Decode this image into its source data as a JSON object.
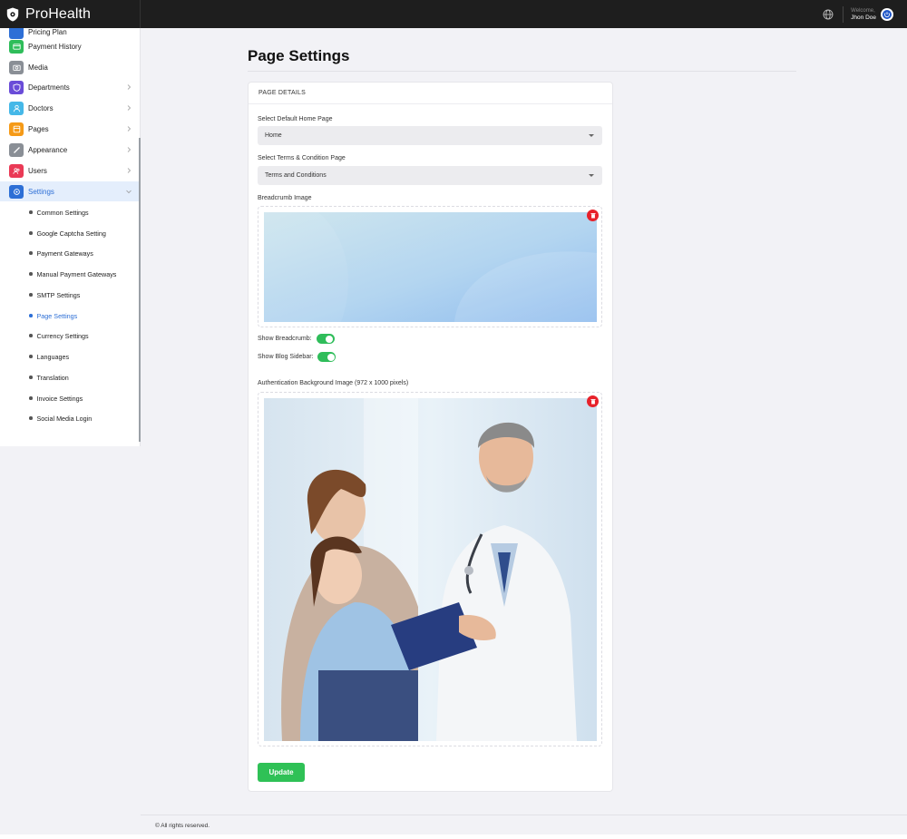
{
  "app": {
    "name": "ProHealth"
  },
  "topbar": {
    "welcome_label": "Welcome,",
    "user_name": "Jhon Doe"
  },
  "sidebar": {
    "partial_item": "Pricing Plan",
    "items": [
      {
        "label": "Payment History",
        "icon": "wallet-icon",
        "color": "#2fbd5a",
        "expandable": false
      },
      {
        "label": "Media",
        "icon": "camera-icon",
        "color": "#8a8f96",
        "expandable": false
      },
      {
        "label": "Departments",
        "icon": "shield-icon",
        "color": "#6a4cd8",
        "expandable": true
      },
      {
        "label": "Doctors",
        "icon": "user-icon",
        "color": "#45b8e8",
        "expandable": true
      },
      {
        "label": "Pages",
        "icon": "pages-icon",
        "color": "#f59a17",
        "expandable": true
      },
      {
        "label": "Appearance",
        "icon": "brush-icon",
        "color": "#8a8f96",
        "expandable": true
      },
      {
        "label": "Users",
        "icon": "users-icon",
        "color": "#ea3a56",
        "expandable": true
      },
      {
        "label": "Settings",
        "icon": "gear-icon",
        "color": "#2d6fd6",
        "expandable": true,
        "active": true
      }
    ],
    "settings_sub": [
      "Common Settings",
      "Google Captcha Setting",
      "Payment Gateways",
      "Manual Payment Gateways",
      "SMTP Settings",
      "Page Settings",
      "Currency Settings",
      "Languages",
      "Translation",
      "Invoice Settings",
      "Social Media Login"
    ],
    "active_sub": "Page Settings"
  },
  "page": {
    "title": "Page Settings",
    "card_header": "PAGE DETAILS",
    "home_page_label": "Select Default Home Page",
    "home_page_value": "Home",
    "terms_label": "Select Terms & Condition Page",
    "terms_value": "Terms and Conditions",
    "breadcrumb_label": "Breadcrumb Image",
    "show_breadcrumb_label": "Show Breadcrumb:",
    "show_breadcrumb": true,
    "show_blog_sidebar_label": "Show Blog Sidebar:",
    "show_blog_sidebar": true,
    "auth_bg_label": "Authentication Background Image (972 x 1000 pixels)",
    "update_label": "Update"
  },
  "footer": {
    "text": "© All rights reserved."
  }
}
